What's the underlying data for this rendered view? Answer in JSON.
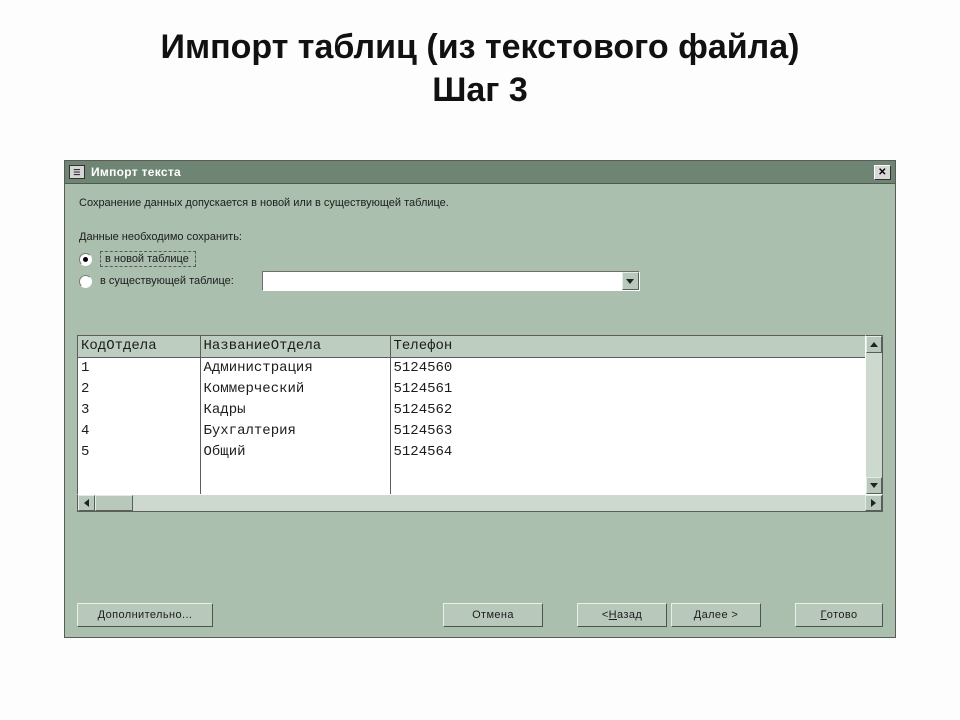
{
  "slide": {
    "title_line1": "Импорт таблиц (из текстового файла)",
    "title_line2": "Шаг 3"
  },
  "dialog": {
    "title": "Импорт текста",
    "close_glyph": "✕",
    "text": {
      "intro": "Сохранение данных допускается в новой или в существующей таблице.",
      "save_prompt": "Данные необходимо сохранить:"
    },
    "radios": {
      "new_table": "в новой таблице",
      "existing_table": "в существующей таблице:",
      "selected": "new_table"
    },
    "combo": {
      "value": ""
    },
    "preview": {
      "columns": [
        "КодОтдела",
        "НазваниеОтдела",
        "Телефон"
      ],
      "col_widths": [
        "122px",
        "190px",
        "auto"
      ],
      "rows": [
        [
          "1",
          "Администрация",
          "5124560"
        ],
        [
          "2",
          "Коммерческий",
          "5124561"
        ],
        [
          "3",
          "Кадры",
          "5124562"
        ],
        [
          "4",
          "Бухгалтерия",
          "5124563"
        ],
        [
          "5",
          "Общий",
          "5124564"
        ]
      ]
    },
    "buttons": {
      "advanced": "Дополнительно...",
      "cancel": "Отмена",
      "back_pre": "< ",
      "back_u": "Н",
      "back_post": "азад",
      "next_u": "Д",
      "next_post": "алее >",
      "finish_u": "Г",
      "finish_post": "отово"
    }
  }
}
